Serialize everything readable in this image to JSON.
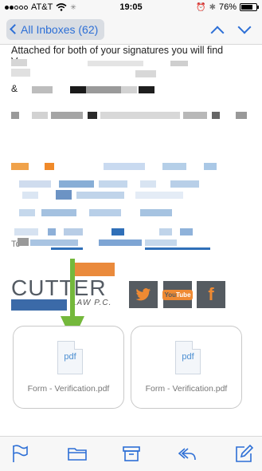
{
  "status_bar": {
    "carrier": "AT&T",
    "time": "19:05",
    "battery": "76%",
    "battery_level": 0.76
  },
  "nav": {
    "back_label": "All Inboxes (62)",
    "up_icon": "chevron-up-icon",
    "down_icon": "chevron-down-icon"
  },
  "message": {
    "intro_line_1": "Attached for both of your signatures you will find",
    "intro_line_2": "V",
    "line_fragment_1": "&",
    "line_fragment_2": "To"
  },
  "signature": {
    "logo_main": "CUTTER",
    "logo_sub": "LAW P.C.",
    "social": [
      {
        "name": "twitter",
        "glyph": "🐦"
      },
      {
        "name": "youtube",
        "glyph": "You Tube"
      },
      {
        "name": "facebook",
        "glyph": "f"
      }
    ]
  },
  "attachments": [
    {
      "icon_label": "pdf",
      "filename": "Form - Verification.pdf"
    },
    {
      "icon_label": "pdf",
      "filename": "Form - Verification.pdf"
    }
  ],
  "toolbar": {
    "icons": [
      "flag-icon",
      "folder-icon",
      "archive-icon",
      "reply-icon",
      "compose-icon"
    ]
  },
  "colors": {
    "accent_blue": "#2d6fd6",
    "arrow_green": "#74b83c",
    "brand_orange": "#ea8a3c",
    "brand_gray": "#545b63"
  }
}
